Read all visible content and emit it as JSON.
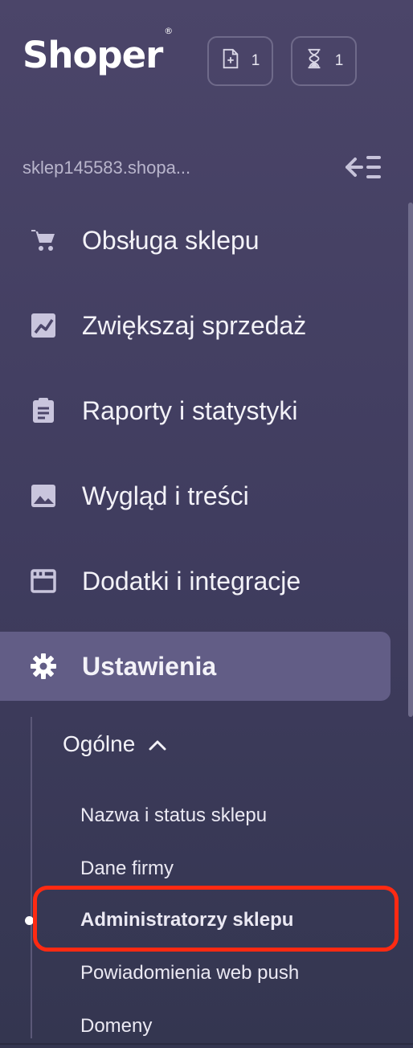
{
  "brand": {
    "name": "Shoper",
    "mark": "®"
  },
  "badges": {
    "orders": {
      "icon": "new-document-icon",
      "count": "1"
    },
    "tasks": {
      "icon": "hourglass-icon",
      "count": "1"
    }
  },
  "store": {
    "url": "sklep145583.shopa..."
  },
  "collapse_icon": "collapse-menu-icon",
  "nav": [
    {
      "label": "Obsługa sklepu",
      "icon": "cart-icon"
    },
    {
      "label": "Zwiększaj sprzedaż",
      "icon": "trend-chart-icon"
    },
    {
      "label": "Raporty i statystyki",
      "icon": "clipboard-icon"
    },
    {
      "label": "Wygląd i treści",
      "icon": "image-icon"
    },
    {
      "label": "Dodatki i integracje",
      "icon": "browser-window-icon"
    },
    {
      "label": "Ustawienia",
      "icon": "gear-icon",
      "active": true
    }
  ],
  "settings": {
    "group": {
      "label": "Ogólne",
      "icon": "chevron-up-icon",
      "expanded": true
    },
    "items": [
      {
        "label": "Nazwa i status sklepu"
      },
      {
        "label": "Dane firmy"
      },
      {
        "label": "Administratorzy sklepu",
        "current": true
      },
      {
        "label": "Powiadomienia web push"
      },
      {
        "label": "Domeny"
      }
    ]
  },
  "colors": {
    "highlight": "#ff2a12",
    "active_bg": "#625d86",
    "sidebar_bg": "#4b4569"
  }
}
